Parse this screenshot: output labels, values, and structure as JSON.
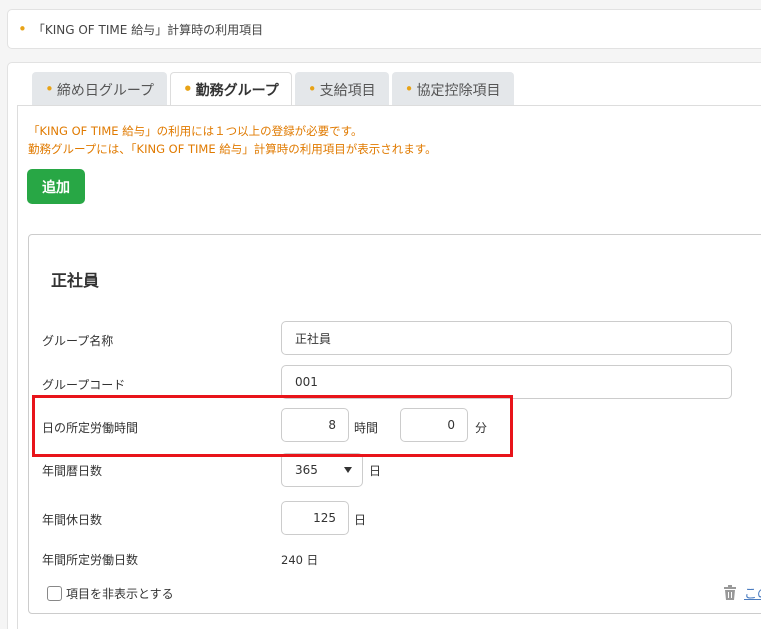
{
  "header": {
    "label": "「KING OF TIME 給与」計算時の利用項目"
  },
  "tabs": [
    {
      "label": "締め日グループ",
      "active": false
    },
    {
      "label": "勤務グループ",
      "active": true
    },
    {
      "label": "支給項目",
      "active": false
    },
    {
      "label": "協定控除項目",
      "active": false
    }
  ],
  "notice": {
    "line1": "「KING OF TIME 給与」の利用には１つ以上の登録が必要です。",
    "line2": "勤務グループには、「KING OF TIME 給与」計算時の利用項目が表示されます。"
  },
  "add_button": {
    "label": "追加"
  },
  "card": {
    "title": "正社員",
    "group_name": {
      "label": "グループ名称",
      "value": "正社員"
    },
    "group_code": {
      "label": "グループコード",
      "value": "001"
    },
    "daily_hours": {
      "label": "日の所定労働時間",
      "hours_value": "8",
      "hours_unit": "時間",
      "minutes_value": "0",
      "minutes_unit": "分"
    },
    "annual_calendar_days": {
      "label": "年間暦日数",
      "value": "365",
      "unit": "日"
    },
    "annual_holidays": {
      "label": "年間休日数",
      "value": "125",
      "unit": "日"
    },
    "annual_work_days": {
      "label": "年間所定労働日数",
      "value": "240 日"
    },
    "hide_checkbox": {
      "label": "項目を非表示とする",
      "checked": false
    },
    "delete_link": {
      "label": "この"
    }
  },
  "colors": {
    "accent_dot": "#e8a317",
    "notice": "#e07a00",
    "add_button": "#28a745",
    "highlight": "#e8141a",
    "link": "#4a7bbf"
  }
}
